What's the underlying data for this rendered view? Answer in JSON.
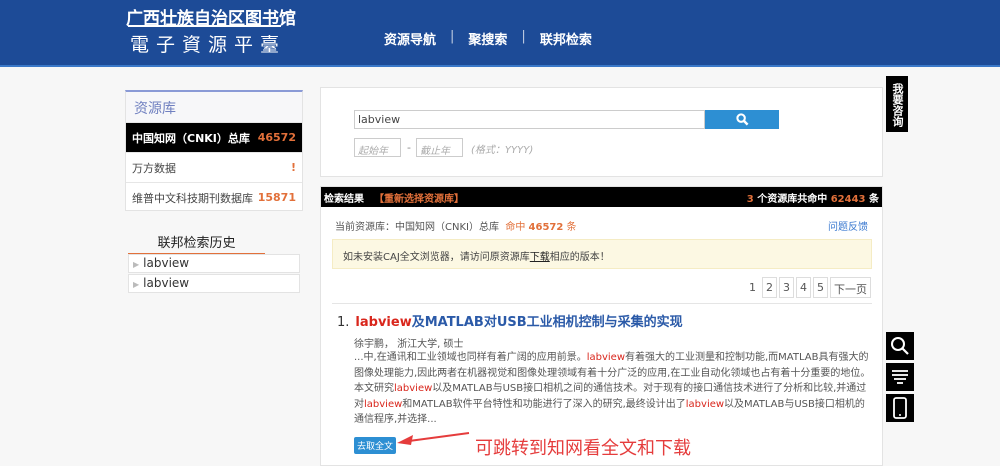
{
  "header": {
    "library_name": "广西壮族自治区图书馆",
    "platform_name": "電子資源平臺",
    "nav": [
      "资源导航",
      "聚搜索",
      "联邦检索"
    ]
  },
  "sidebar": {
    "title": "资源库",
    "items": [
      {
        "label": "中国知网（CNKI）总库",
        "count": "46572"
      },
      {
        "label": "万方数据",
        "count": "!"
      },
      {
        "label": "维普中文科技期刊数据库",
        "count": "15871"
      }
    ],
    "history_title": "联邦检索历史",
    "history": [
      "labview",
      "labview"
    ]
  },
  "search": {
    "query": "labview",
    "start_year_placeholder": "起始年",
    "end_year_placeholder": "截止年",
    "dash": "-",
    "format_hint": "(格式：YYYY)"
  },
  "results": {
    "label": "检索结果",
    "reselect": "【重新选择资源库】",
    "summary_count": "3",
    "summary_text": "个资源库共命中",
    "total": "62443",
    "unit": "条",
    "current_label": "当前资源库：中国知网（CNKI）总库",
    "hit_label": "命中",
    "hit_count": "46572",
    "hit_unit": "条",
    "feedback": "问题反馈",
    "notice_before": "如未安装CAJ全文浏览器，请访问原资源库",
    "notice_link": "下载",
    "notice_after": "相应的版本！",
    "pages": [
      "1",
      "2",
      "3",
      "4",
      "5",
      "下一页"
    ],
    "items": [
      {
        "index": "1.",
        "title_kw": "labview",
        "title_rest": "及MATLAB对USB工业相机控制与采集的实现",
        "authors": "徐宇鹏，  浙江大学, 硕士",
        "abstract": [
          {
            "t": "...中,在通讯和工业领域也同样有着广阔的应用前景。"
          },
          {
            "k": "labview"
          },
          {
            "t": "有着强大的工业测量和控制功能,而MATLAB具有强大的图像处理能力,因此两者在机器视觉和图像处理领域有着十分广泛的应用,在工业自动化领域也占有着十分重要的地位。本文研究"
          },
          {
            "k": "labview"
          },
          {
            "t": "以及MATLAB与USB接口相机之间的通信技术。对于现有的接口通信技术进行了分析和比较,并通过对"
          },
          {
            "k": "labview"
          },
          {
            "t": "和MATLAB软件平台特性和功能进行了深入的研究,最终设计出了"
          },
          {
            "k": "labview"
          },
          {
            "t": "以及MATLAB与USB接口相机的通信程序,并选择..."
          }
        ],
        "get_fulltext": "去取全文"
      }
    ]
  },
  "annotation": "可跳转到知网看全文和下载",
  "float": {
    "consult": "我要咨询"
  }
}
